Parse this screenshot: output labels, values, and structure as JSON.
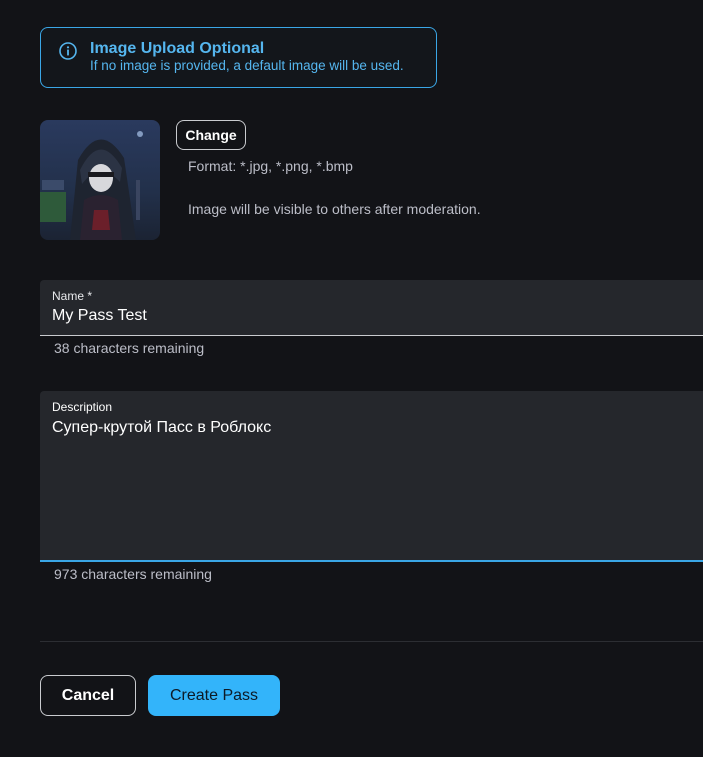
{
  "alert": {
    "icon": "info-icon",
    "title": "Image Upload Optional",
    "text": "If no image is provided, a default image will be used.",
    "color": "#55b6ef"
  },
  "image": {
    "change_label": "Change",
    "format_text": "Format: *.jpg, *.png, *.bmp",
    "moderation_text": "Image will be visible to others after moderation."
  },
  "name_field": {
    "label": "Name *",
    "value": "My Pass Test",
    "helper": "38 characters remaining"
  },
  "description_field": {
    "label": "Description",
    "value": "Супер-крутой Пасс в Роблокс",
    "helper": "973 characters remaining"
  },
  "actions": {
    "cancel_label": "Cancel",
    "create_label": "Create Pass",
    "accent_color": "#33b4fa"
  }
}
